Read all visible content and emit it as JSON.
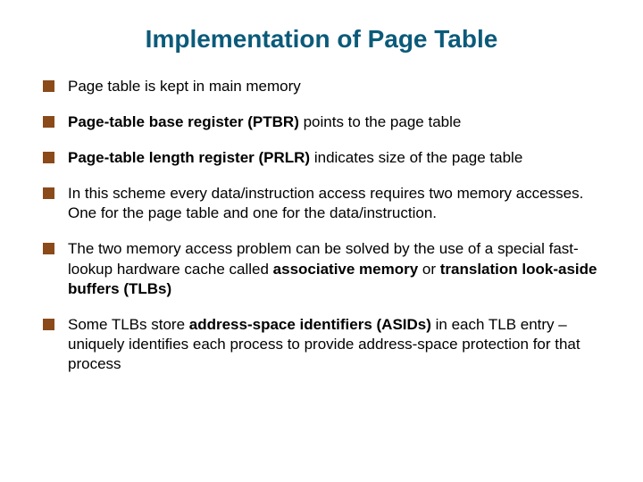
{
  "title": "Implementation of Page Table",
  "bullets": {
    "b0": {
      "t0": "Page table is kept in main memory"
    },
    "b1": {
      "t0": "Page-table base register (PTBR)",
      "t1": " points to the page table"
    },
    "b2": {
      "t0": "Page-table length register (PRLR)",
      "t1": " indicates size of the page table"
    },
    "b3": {
      "t0": "In this scheme every data/instruction access requires two memory accesses.  One for the page table and one for the data/instruction."
    },
    "b4": {
      "t0": "The two memory access problem can be solved by the use of a special fast-lookup hardware cache called ",
      "t1": "associative memory",
      "t2": " or ",
      "t3": "translation look-aside buffers (TLBs)"
    },
    "b5": {
      "t0": "Some TLBs store ",
      "t1": "address-space identifiers (ASIDs)",
      "t2": " in each TLB entry – uniquely identifies each process to provide address-space protection for that process"
    }
  }
}
